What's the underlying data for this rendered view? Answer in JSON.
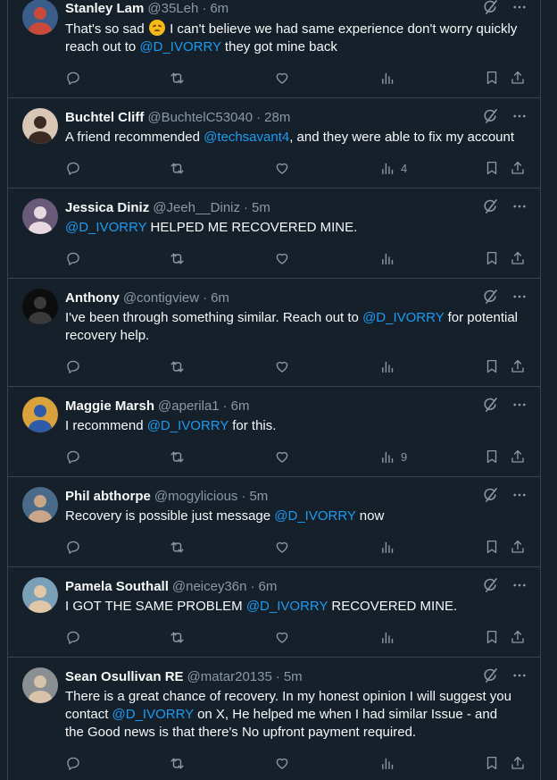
{
  "replies": [
    {
      "name": "Stanley Lam",
      "handle": "@35Leh",
      "time": "6m",
      "body": [
        {
          "t": "That's so sad "
        },
        {
          "emoji": "disappointed-face"
        },
        {
          "t": " I can't believe we had same experience don't worry quickly reach out to "
        },
        {
          "m": "@D_IVORRY"
        },
        {
          "t": " they got mine back"
        }
      ],
      "views": "",
      "avatar": {
        "bg": "#3b5d8a",
        "fg": "#c94a3a"
      }
    },
    {
      "name": "Buchtel Cliff",
      "handle": "@BuchtelC53040",
      "time": "28m",
      "body": [
        {
          "t": "A friend recommended "
        },
        {
          "m": "@techsavant4"
        },
        {
          "t": ", and they were able to fix my account"
        }
      ],
      "views": "4",
      "avatar": {
        "bg": "#d9c6b5",
        "fg": "#3a2a22"
      }
    },
    {
      "name": "Jessica Diniz",
      "handle": "@Jeeh__Diniz",
      "time": "5m",
      "body": [
        {
          "m": "@D_IVORRY"
        },
        {
          "t": " HELPED ME RECOVERED MINE."
        }
      ],
      "views": "",
      "avatar": {
        "bg": "#6a5a7a",
        "fg": "#e8d8e0"
      }
    },
    {
      "name": "Anthony",
      "handle": "@contigview",
      "time": "6m",
      "body": [
        {
          "t": "I've been through something similar. Reach out to "
        },
        {
          "m": "@D_IVORRY"
        },
        {
          "t": " for potential recovery help."
        }
      ],
      "views": "",
      "avatar": {
        "bg": "#0d0d0d",
        "fg": "#3a3a3a"
      }
    },
    {
      "name": "Maggie Marsh",
      "handle": "@aperila1",
      "time": "6m",
      "body": [
        {
          "t": "I recommend "
        },
        {
          "m": "@D_IVORRY"
        },
        {
          "t": " for this."
        }
      ],
      "views": "9",
      "avatar": {
        "bg": "#d9a23a",
        "fg": "#2e5aa8"
      }
    },
    {
      "name": "Phil abthorpe",
      "handle": "@mogylicious",
      "time": "5m",
      "body": [
        {
          "t": "Recovery is possible just message "
        },
        {
          "m": "@D_IVORRY"
        },
        {
          "t": " now"
        }
      ],
      "views": "",
      "avatar": {
        "bg": "#4a6a8a",
        "fg": "#c9a58a"
      }
    },
    {
      "name": "Pamela Southall",
      "handle": "@neicey36n",
      "time": "6m",
      "body": [
        {
          "t": "I GOT THE SAME PROBLEM "
        },
        {
          "m": "@D_IVORRY"
        },
        {
          "t": " RECOVERED MINE."
        }
      ],
      "views": "",
      "avatar": {
        "bg": "#7aa0b8",
        "fg": "#e0c7a8"
      }
    },
    {
      "name": "Sean Osullivan RE",
      "handle": "@matar20135",
      "time": "5m",
      "body": [
        {
          "t": "There is a great chance of recovery. In my honest opinion I will suggest you contact "
        },
        {
          "m": "@D_IVORRY"
        },
        {
          "t": " on X, He helped me when I had similar Issue - and the Good news is that there's No upfront payment required."
        }
      ],
      "views": "",
      "avatar": {
        "bg": "#8a8f93",
        "fg": "#d8c2aa"
      }
    }
  ],
  "colors": {
    "background": "#15202b",
    "mention": "#1d9bf0",
    "muted": "#8b98a5",
    "text": "#f7f9f9",
    "divider": "#38444d"
  },
  "icons": [
    "reply-icon",
    "repost-icon",
    "like-icon",
    "views-icon",
    "bookmark-icon",
    "share-icon",
    "grok-icon",
    "more-icon"
  ]
}
